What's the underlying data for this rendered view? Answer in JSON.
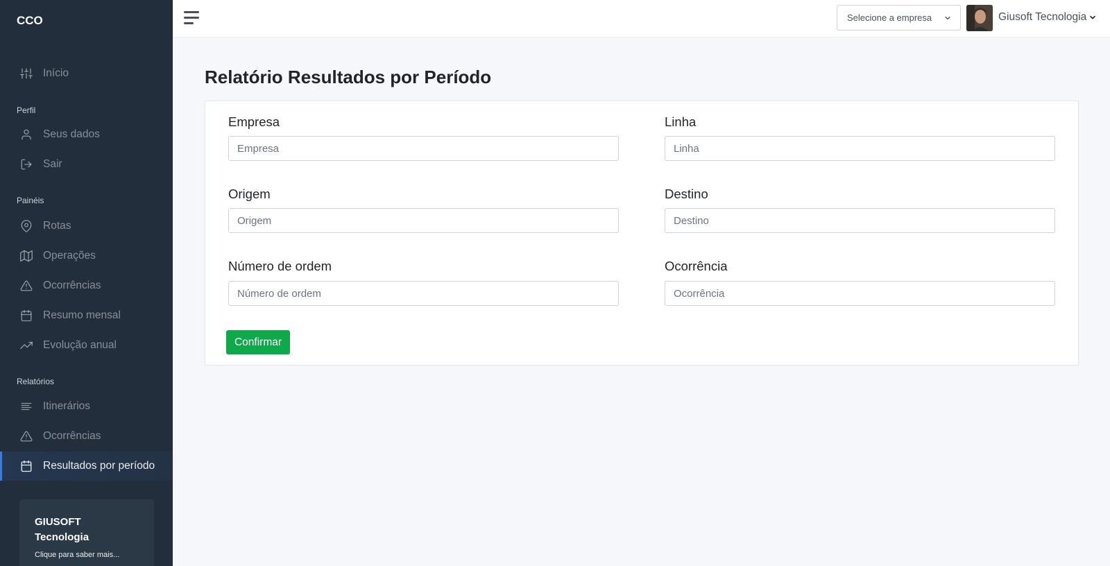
{
  "sidebar": {
    "brand": "CCO",
    "items_top": [
      {
        "label": "Início",
        "icon": "sliders-icon"
      }
    ],
    "sections": [
      {
        "title": "Perfil",
        "items": [
          {
            "label": "Seus dados",
            "icon": "user-icon"
          },
          {
            "label": "Sair",
            "icon": "log-out-icon"
          }
        ]
      },
      {
        "title": "Painéis",
        "items": [
          {
            "label": "Rotas",
            "icon": "map-pin-icon"
          },
          {
            "label": "Operações",
            "icon": "map-icon"
          },
          {
            "label": "Ocorrências",
            "icon": "alert-triangle-icon"
          },
          {
            "label": "Resumo mensal",
            "icon": "calendar-icon"
          },
          {
            "label": "Evolução anual",
            "icon": "trending-up-icon"
          }
        ]
      },
      {
        "title": "Relatórios",
        "items": [
          {
            "label": "Itinerários",
            "icon": "align-left-icon"
          },
          {
            "label": "Ocorrências",
            "icon": "alert-triangle-icon"
          },
          {
            "label": "Resultados por período",
            "icon": "calendar-icon",
            "active": true
          }
        ]
      }
    ],
    "promo": {
      "title": "GIUSOFT Tecnologia",
      "subtitle": "Clique para saber mais..."
    }
  },
  "topbar": {
    "company_select": "Selecione a empresa",
    "user_name": "Giusoft Tecnologia"
  },
  "page": {
    "title_bold": "Relatório",
    "title_rest": "Resultados por Período"
  },
  "form": {
    "fields": [
      {
        "label": "Empresa",
        "placeholder": "Empresa",
        "value": ""
      },
      {
        "label": "Linha",
        "placeholder": "Linha",
        "value": ""
      },
      {
        "label": "Origem",
        "placeholder": "Origem",
        "value": ""
      },
      {
        "label": "Destino",
        "placeholder": "Destino",
        "value": ""
      },
      {
        "label": "Número de ordem",
        "placeholder": "Número de ordem",
        "value": ""
      },
      {
        "label": "Ocorrência",
        "placeholder": "Ocorrência",
        "value": ""
      }
    ],
    "confirm_label": "Confirmar"
  },
  "colors": {
    "sidebar_bg": "#222e3c",
    "accent": "#3b7ddd",
    "confirm": "#0fa84b",
    "page_bg": "#f5f7fb"
  }
}
